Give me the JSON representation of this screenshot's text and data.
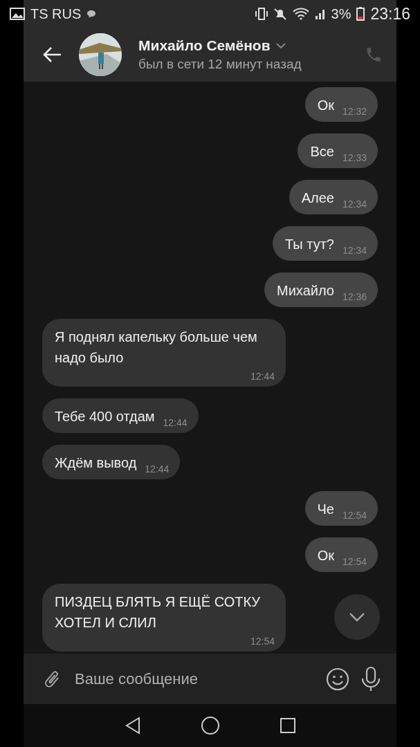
{
  "status_bar": {
    "carrier": "TS RUS",
    "battery": "3%",
    "time": "23:16"
  },
  "header": {
    "name": "Михайло Семёнов",
    "status": "был в сети 12 минут назад"
  },
  "messages": [
    {
      "text": "Ок",
      "time": "12:32",
      "outgoing": true
    },
    {
      "text": "Все",
      "time": "12:33",
      "outgoing": true
    },
    {
      "text": "Алее",
      "time": "12:34",
      "outgoing": true
    },
    {
      "text": "Ты тут?",
      "time": "12:34",
      "outgoing": true
    },
    {
      "text": "Михайло",
      "time": "12:36",
      "outgoing": true
    },
    {
      "text": "Я поднял капельку больше чем надо было",
      "time": "12:44",
      "outgoing": false
    },
    {
      "text": "Тебе 400 отдам",
      "time": "12:44",
      "outgoing": false
    },
    {
      "text": "Ждём вывод",
      "time": "12:44",
      "outgoing": false
    },
    {
      "text": "Че",
      "time": "12:54",
      "outgoing": true
    },
    {
      "text": "Ок",
      "time": "12:54",
      "outgoing": true
    },
    {
      "text": "ПИЗДЕЦ БЛЯТЬ Я ЕЩЁ СОТКУ ХОТЕЛ И СЛИЛ",
      "time": "12:54",
      "outgoing": false
    }
  ],
  "composer": {
    "placeholder": "Ваше сообщение"
  }
}
